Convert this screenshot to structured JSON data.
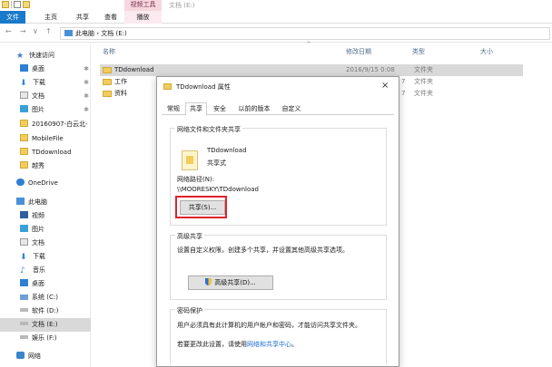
{
  "titlebar": {
    "context_tab": "视频工具",
    "window_title": "文档 (E:)"
  },
  "ribbon": {
    "tabs": [
      "文件",
      "主页",
      "共享",
      "查看",
      "播放"
    ]
  },
  "addressbar": {
    "nav": [
      "←",
      "→",
      "∨",
      "↑"
    ],
    "path": "此电脑 › 文档 (E:)"
  },
  "sidebar": {
    "items": [
      {
        "label": "快速访问",
        "icon": "star-icon",
        "pinned": false
      },
      {
        "label": "桌面",
        "icon": "desktop-icon",
        "pinned": true
      },
      {
        "label": "下载",
        "icon": "download-icon",
        "pinned": true
      },
      {
        "label": "文档",
        "icon": "document-icon",
        "pinned": true
      },
      {
        "label": "图片",
        "icon": "pictures-icon",
        "pinned": true
      },
      {
        "label": "20160907-白云北-",
        "icon": "folder-icon",
        "pinned": false
      },
      {
        "label": "MobileFile",
        "icon": "folder-icon",
        "pinned": false
      },
      {
        "label": "TDdownload",
        "icon": "folder-icon",
        "pinned": false
      },
      {
        "label": "越秀",
        "icon": "folder-icon",
        "pinned": false
      },
      {
        "label": "OneDrive",
        "icon": "onedrive-icon",
        "pinned": false
      },
      {
        "label": "此电脑",
        "icon": "pc-icon",
        "pinned": false
      },
      {
        "label": "视频",
        "icon": "video-icon",
        "pinned": false
      },
      {
        "label": "图片",
        "icon": "pictures-icon",
        "pinned": false
      },
      {
        "label": "文档",
        "icon": "document-icon",
        "pinned": false
      },
      {
        "label": "下载",
        "icon": "download-icon",
        "pinned": false
      },
      {
        "label": "音乐",
        "icon": "music-icon",
        "pinned": false
      },
      {
        "label": "桌面",
        "icon": "desktop-icon",
        "pinned": false
      },
      {
        "label": "系统 (C:)",
        "icon": "system-drive-icon",
        "pinned": false
      },
      {
        "label": "软件 (D:)",
        "icon": "drive-icon",
        "pinned": false
      },
      {
        "label": "文档 (E:)",
        "icon": "drive-icon",
        "pinned": false,
        "selected": true
      },
      {
        "label": "娱乐 (F:)",
        "icon": "drive-icon",
        "pinned": false
      },
      {
        "label": "网络",
        "icon": "network-icon",
        "pinned": false
      }
    ],
    "pin_glyph": "✱"
  },
  "filelist": {
    "headers": {
      "name": "名称",
      "date": "修改日期",
      "type": "类型",
      "size": "大小"
    },
    "rows": [
      {
        "name": "TDdownload",
        "date": "2016/9/15 0:08",
        "type": "文件夹",
        "selected": true
      },
      {
        "name": "工作",
        "date": "7",
        "type": "文件夹"
      },
      {
        "name": "资料",
        "date": "7",
        "type": "文件夹"
      }
    ]
  },
  "dialog": {
    "title": "TDdownload 属性",
    "close": "×",
    "tabs": [
      "常规",
      "共享",
      "安全",
      "以前的版本",
      "自定义"
    ],
    "network_group": {
      "title": "网络文件和文件夹共享",
      "folder_name": "TDdownload",
      "status": "共享式",
      "path_label": "网络路径(N):",
      "path": "\\\\MOORESKY\\TDdownload",
      "share_button": "共享(S)..."
    },
    "advanced_group": {
      "title": "高级共享",
      "description": "设置自定义权限，创建多个共享，并设置其他高级共享选项。",
      "button": "高级共享(D)..."
    },
    "password_group": {
      "title": "密码保护",
      "description": "用户必须具有此计算机的用户帐户和密码，才能访问共享文件夹。",
      "change_prefix": "若要更改此设置，请使用",
      "change_link": "网络和共享中心",
      "change_suffix": "。"
    }
  }
}
